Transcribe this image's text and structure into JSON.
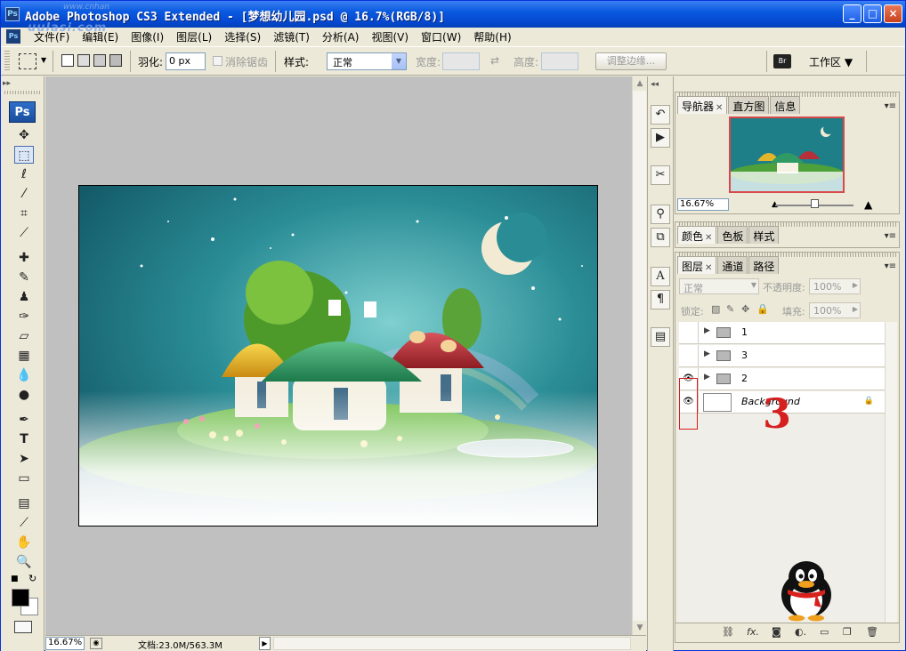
{
  "window": {
    "app_icon": "Ps",
    "title": "Adobe Photoshop CS3 Extended - [梦想幼儿园.psd @ 16.7%(RGB/8)]",
    "watermark": "uulasi.com",
    "watermark_small": "www.cnhan"
  },
  "menu": {
    "items": [
      "文件(F)",
      "编辑(E)",
      "图像(I)",
      "图层(L)",
      "选择(S)",
      "滤镜(T)",
      "分析(A)",
      "视图(V)",
      "窗口(W)",
      "帮助(H)"
    ]
  },
  "options": {
    "feather_label": "羽化:",
    "feather_value": "0 px",
    "antialias_label": "消除锯齿",
    "style_label": "样式:",
    "style_value": "正常",
    "width_label": "宽度:",
    "height_label": "高度:",
    "refine_edge": "调整边缘...",
    "workspace": "工作区 ▼"
  },
  "toolbox": {
    "logo": "Ps"
  },
  "status": {
    "zoom": "16.67%",
    "doc": "文档:23.0M/563.3M"
  },
  "navigator": {
    "tabs": [
      "导航器",
      "直方图",
      "信息"
    ],
    "zoom": "16.67%"
  },
  "color_panel": {
    "tabs": [
      "颜色",
      "色板",
      "样式"
    ]
  },
  "layers_panel": {
    "tabs": [
      "图层",
      "通道",
      "路径"
    ],
    "blend_mode": "正常",
    "opacity_label": "不透明度:",
    "opacity_value": "100%",
    "lock_label": "锁定:",
    "fill_label": "填充:",
    "fill_value": "100%",
    "layers": [
      {
        "name": "1",
        "visible": false,
        "type": "group"
      },
      {
        "name": "3",
        "visible": false,
        "type": "group"
      },
      {
        "name": "2",
        "visible": true,
        "type": "group"
      },
      {
        "name": "Background",
        "visible": true,
        "type": "background"
      }
    ],
    "annotation": "3"
  },
  "colors": {
    "title_bar": "#0548d0",
    "annotation_red": "#d61f1f",
    "sky": "#1d7a86"
  }
}
